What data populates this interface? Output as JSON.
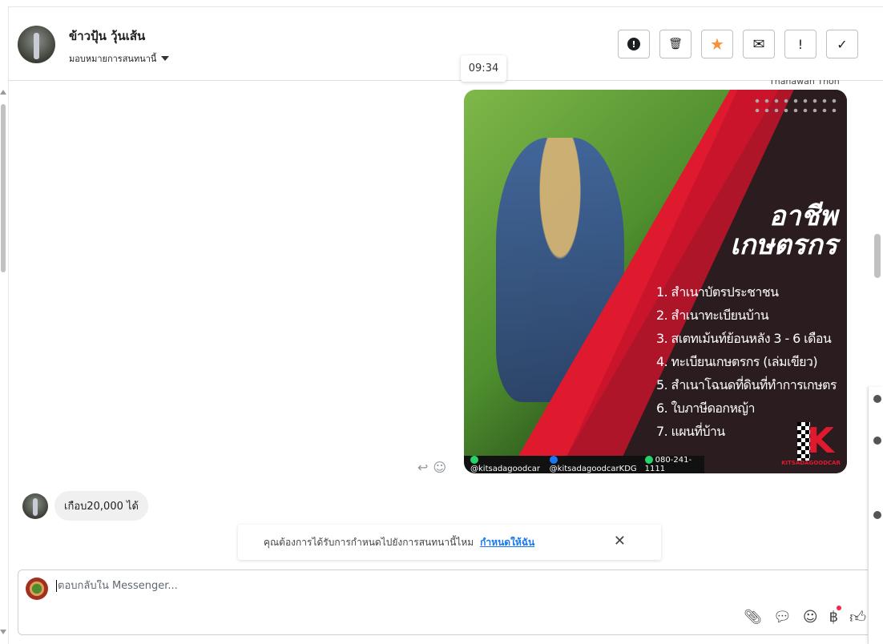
{
  "header": {
    "contact_name": "ข้าวปุ้น วุ้นเส้น",
    "assign_label": "มอบหมายการสนทนานี้",
    "actions": [
      {
        "name": "report",
        "icon": "alert-circle-icon",
        "glyph": "❗"
      },
      {
        "name": "delete",
        "icon": "trash-icon",
        "glyph": "🗑"
      },
      {
        "name": "star",
        "icon": "star-icon",
        "glyph": "★"
      },
      {
        "name": "mark-unread",
        "icon": "envelope-icon",
        "glyph": "✉"
      },
      {
        "name": "priority",
        "icon": "exclamation-icon",
        "glyph": "!"
      },
      {
        "name": "done",
        "icon": "check-icon",
        "glyph": "✓"
      }
    ]
  },
  "tooltip_time": "09:34",
  "cut_text": "Thanawan Thon",
  "ad_image": {
    "title_line1": "อาชีพ",
    "title_line2": "เกษตรกร",
    "items": [
      "1. สำเนาบัตรประชาชน",
      "2. สำเนาทะเบียนบ้าน",
      "3. สเตทเม้นท์ย้อนหลัง 3 - 6 เดือน",
      "4. ทะเบียนเกษตรกร (เล่มเขียว)",
      "5. สำเนาโฉนดที่ดินที่ทำการเกษตร",
      "6. ใบภาษีดอกหญ้า",
      "7. แผนที่บ้าน"
    ],
    "brand": "KITSADAGOODCAR",
    "logo_letter": "K",
    "line": "@kitsadagoodcar",
    "facebook": "@kitsadagoodcarKDG",
    "phone": "080-241-1111"
  },
  "incoming_message": "เกือบ20,000 ได้",
  "notice": {
    "text": "คุณต้องการได้รับการกำหนดไปยังการสนทนานี้ไหม",
    "link": "กำหนดให้ฉัน"
  },
  "composer": {
    "placeholder": "ตอบกลับใน Messenger..."
  },
  "colors": {
    "accent": "#1877f2",
    "star": "#f7923a",
    "notification": "#f02849"
  }
}
